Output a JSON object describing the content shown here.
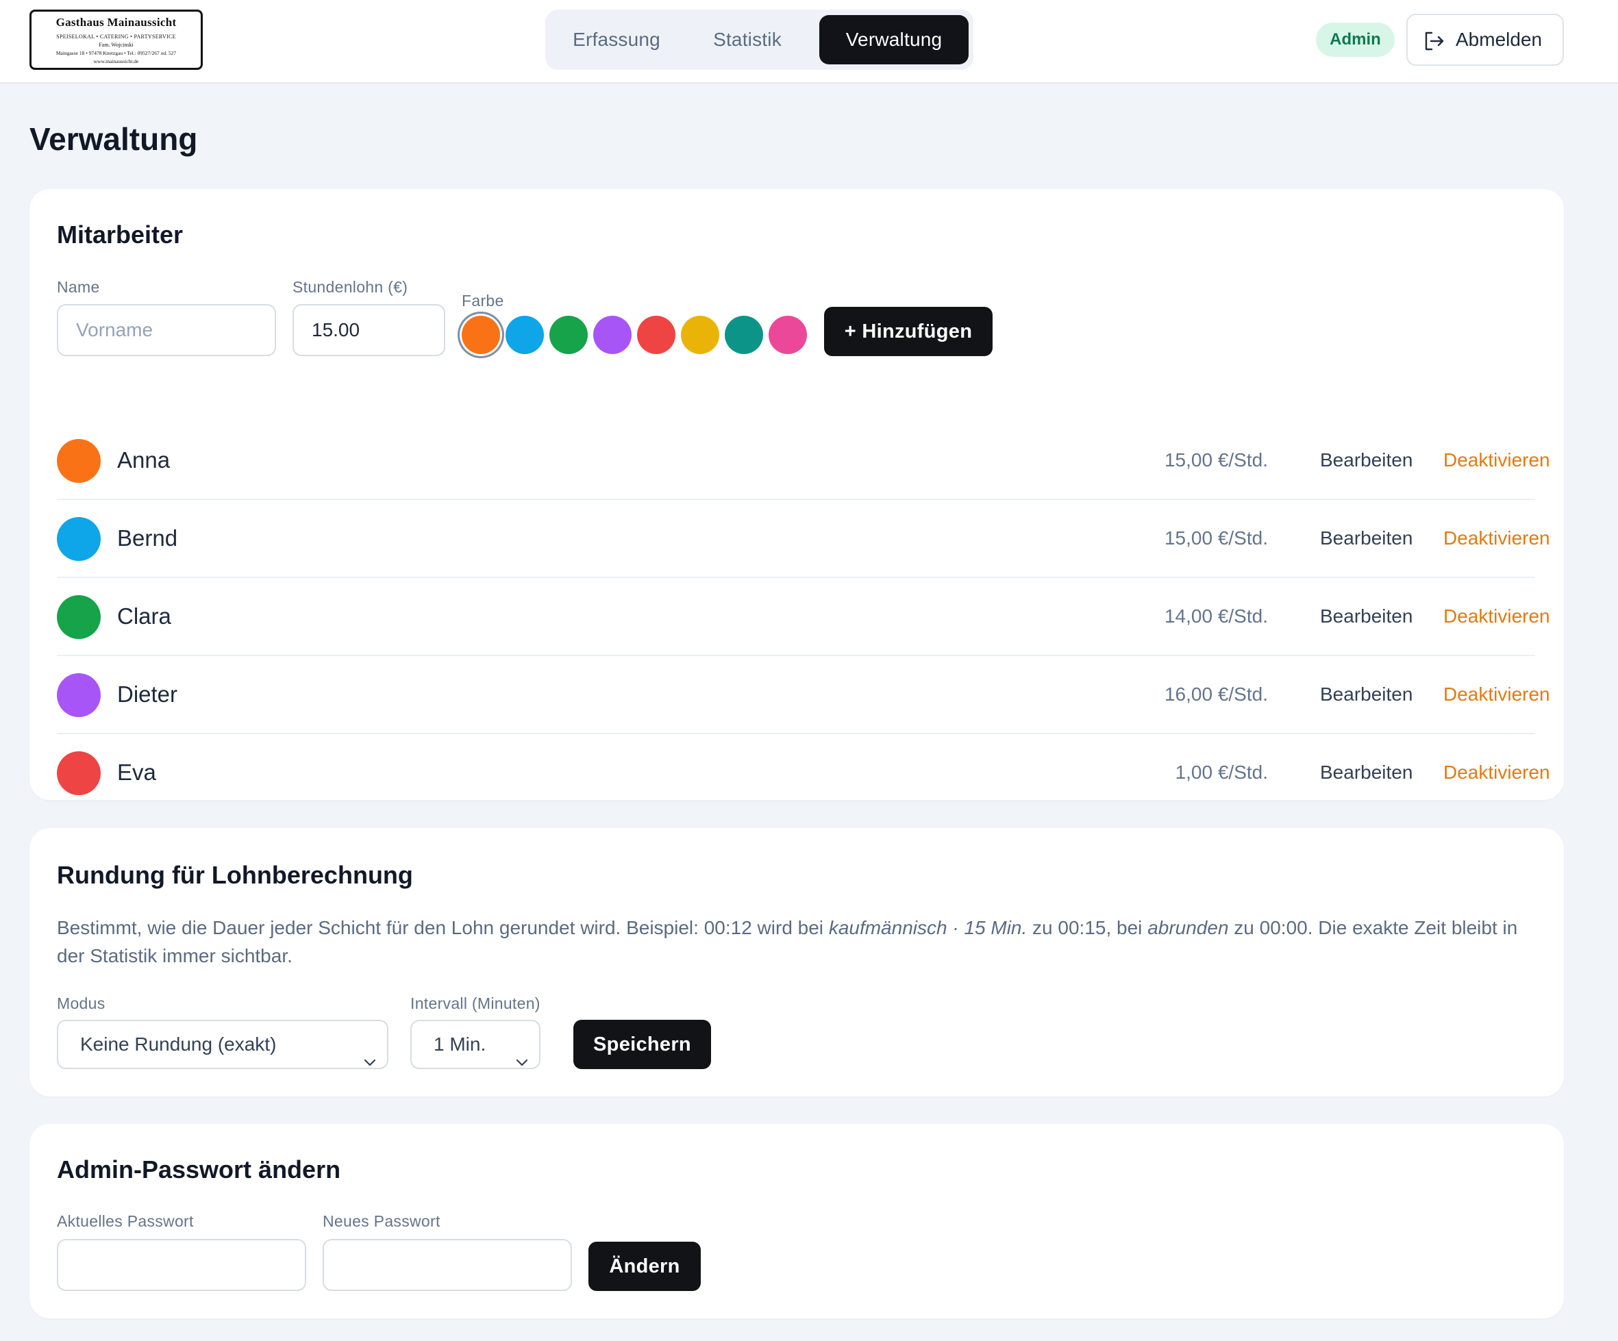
{
  "logo": {
    "line1": "Gasthaus Mainaussicht",
    "line2": "SPEISELOKAL • CATERING • PARTYSERVICE",
    "line3": "Fam. Wojcinski",
    "line4": "Maingasse 18 • 97478 Knetzgau • Tel.: 09527/267 od. 527",
    "line5": "www.mainaussicht.de"
  },
  "nav": {
    "tabs": [
      {
        "label": "Erfassung",
        "active": false
      },
      {
        "label": "Statistik",
        "active": false
      },
      {
        "label": "Verwaltung",
        "active": true
      }
    ]
  },
  "header": {
    "role_badge": "Admin",
    "logout_label": "Abmelden",
    "logout_icon": "logout-icon"
  },
  "page": {
    "title": "Verwaltung"
  },
  "employees": {
    "title": "Mitarbeiter",
    "form": {
      "name_label": "Name",
      "name_placeholder": "Vorname",
      "name_value": "",
      "wage_label": "Stundenlohn (€)",
      "wage_value": "15.00",
      "color_label": "Farbe",
      "colors": [
        "#f97316",
        "#0ea5e9",
        "#16a34a",
        "#a855f7",
        "#ef4444",
        "#eab308",
        "#0d9488",
        "#ec4899"
      ],
      "selected_color_index": 0,
      "add_button": "+ Hinzufügen"
    },
    "edit_label": "Bearbeiten",
    "deactivate_label": "Deaktivieren",
    "list": [
      {
        "name": "Anna",
        "rate": "15,00 €/Std.",
        "color": "#f97316"
      },
      {
        "name": "Bernd",
        "rate": "15,00 €/Std.",
        "color": "#0ea5e9"
      },
      {
        "name": "Clara",
        "rate": "14,00 €/Std.",
        "color": "#16a34a"
      },
      {
        "name": "Dieter",
        "rate": "16,00 €/Std.",
        "color": "#a855f7"
      },
      {
        "name": "Eva",
        "rate": "1,00 €/Std.",
        "color": "#ef4444"
      }
    ]
  },
  "rounding": {
    "title": "Rundung für Lohnberechnung",
    "desc_part1": "Bestimmt, wie die Dauer jeder Schicht für den Lohn gerundet wird. Beispiel: 00:12 wird bei ",
    "desc_em1": "kaufmännisch · 15 Min.",
    "desc_part2": " zu 00:15, bei ",
    "desc_em2": "abrunden",
    "desc_part3": " zu 00:00. Die exakte Zeit bleibt in der Statistik immer sichtbar.",
    "mode_label": "Modus",
    "mode_value": "Keine Rundung (exakt)",
    "interval_label": "Intervall (Minuten)",
    "interval_value": "1 Min.",
    "save_button": "Speichern"
  },
  "password": {
    "title": "Admin-Passwort ändern",
    "current_label": "Aktuelles Passwort",
    "current_value": "",
    "new_label": "Neues Passwort",
    "new_value": "",
    "change_button": "Ändern"
  }
}
